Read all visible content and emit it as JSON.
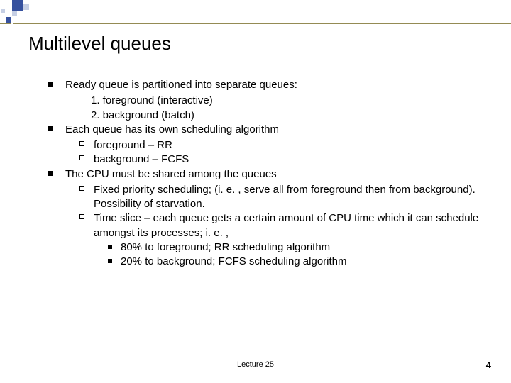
{
  "title": "Multilevel queues",
  "bullets": {
    "b1": {
      "main": "Ready queue is partitioned into separate queues:",
      "n1": "1. foreground (interactive)",
      "n2": "2. background (batch)"
    },
    "b2": {
      "main": "Each queue has its own scheduling algorithm",
      "s1": "foreground – RR",
      "s2": "background – FCFS"
    },
    "b3": {
      "main": "The CPU must be shared among the queues",
      "s1": "Fixed priority scheduling; (i. e. , serve all from foreground then from background).  Possibility of starvation.",
      "s2": "Time slice – each queue gets a certain amount of CPU time which it can schedule amongst its processes; i. e. ,",
      "t1": "80% to foreground;  RR scheduling algorithm",
      "t2": "20% to background;  FCFS scheduling algorithm"
    }
  },
  "footer": {
    "center": "Lecture 25",
    "pagenum": "4"
  }
}
